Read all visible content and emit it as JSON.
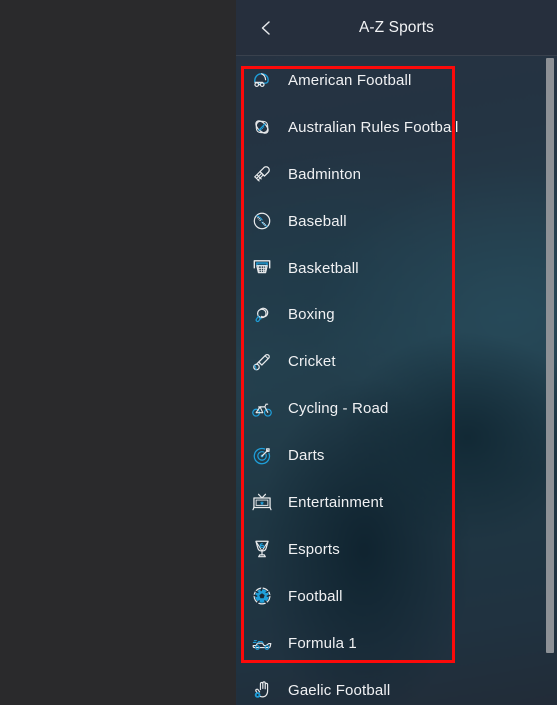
{
  "header": {
    "title": "A-Z Sports",
    "back_icon": "chevron-left-icon"
  },
  "colors": {
    "icon_accent": "#1f9ed9",
    "icon_stroke": "#e8eaec",
    "text": "#f0f1f3",
    "panel_bg": "#253040",
    "header_bg": "#262f3d",
    "annotation": "#fc0a0a",
    "scrollbar": "#8d9196"
  },
  "annotation": {
    "type": "red-rectangle-highlight",
    "covers_items": [
      "American Football",
      "Formula 1"
    ]
  },
  "sports_list": {
    "items": [
      {
        "label": "American Football",
        "icon": "american-football-helmet-icon"
      },
      {
        "label": "Australian Rules Football",
        "icon": "aussie-rules-ball-icon"
      },
      {
        "label": "Badminton",
        "icon": "badminton-shuttlecock-icon"
      },
      {
        "label": "Baseball",
        "icon": "baseball-ball-icon"
      },
      {
        "label": "Basketball",
        "icon": "basketball-hoop-icon"
      },
      {
        "label": "Boxing",
        "icon": "boxing-glove-icon"
      },
      {
        "label": "Cricket",
        "icon": "cricket-bat-ball-icon"
      },
      {
        "label": "Cycling - Road",
        "icon": "bicycle-icon"
      },
      {
        "label": "Darts",
        "icon": "dartboard-icon"
      },
      {
        "label": "Entertainment",
        "icon": "television-icon"
      },
      {
        "label": "Esports",
        "icon": "esports-trophy-icon"
      },
      {
        "label": "Football",
        "icon": "soccer-ball-icon"
      },
      {
        "label": "Formula 1",
        "icon": "racing-car-icon"
      },
      {
        "label": "Gaelic Football",
        "icon": "gaelic-football-hand-icon"
      }
    ]
  },
  "scrollbar": {
    "name": "vertical-scrollbar",
    "position": "top"
  }
}
